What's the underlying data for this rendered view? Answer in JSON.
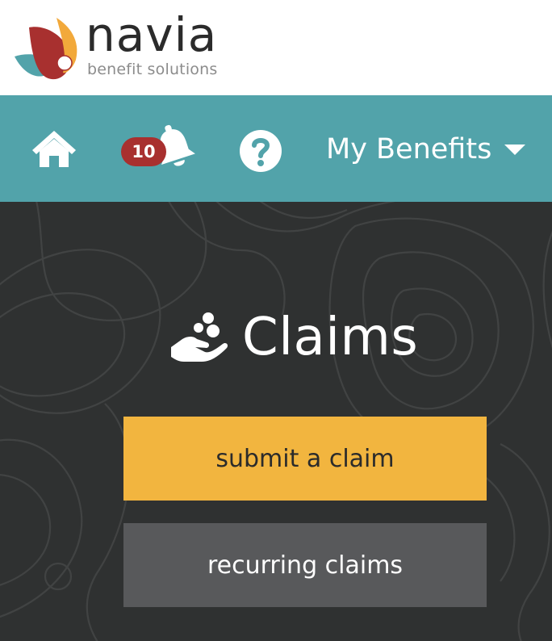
{
  "brand": {
    "name": "navia",
    "tagline": "benefit solutions",
    "colors": {
      "flame_red": "#a8302f",
      "flame_orange": "#f2a93b",
      "flame_teal": "#52a3aa"
    }
  },
  "navbar": {
    "background": "#52a3aa",
    "home_icon": "home-icon",
    "notifications": {
      "icon": "bell-icon",
      "count": "10",
      "badge_color": "#a8302f"
    },
    "help_icon": "question-circle-icon",
    "benefits_menu": {
      "label": "My Benefits",
      "icon": "caret-down-icon"
    }
  },
  "main": {
    "background": "#2f3131",
    "title": {
      "icon": "hand-holding-coins-icon",
      "text": "Claims"
    },
    "buttons": {
      "submit": {
        "label": "submit a claim",
        "color": "#f2b53f"
      },
      "recurring": {
        "label": "recurring claims",
        "color": "#58595b"
      }
    }
  }
}
